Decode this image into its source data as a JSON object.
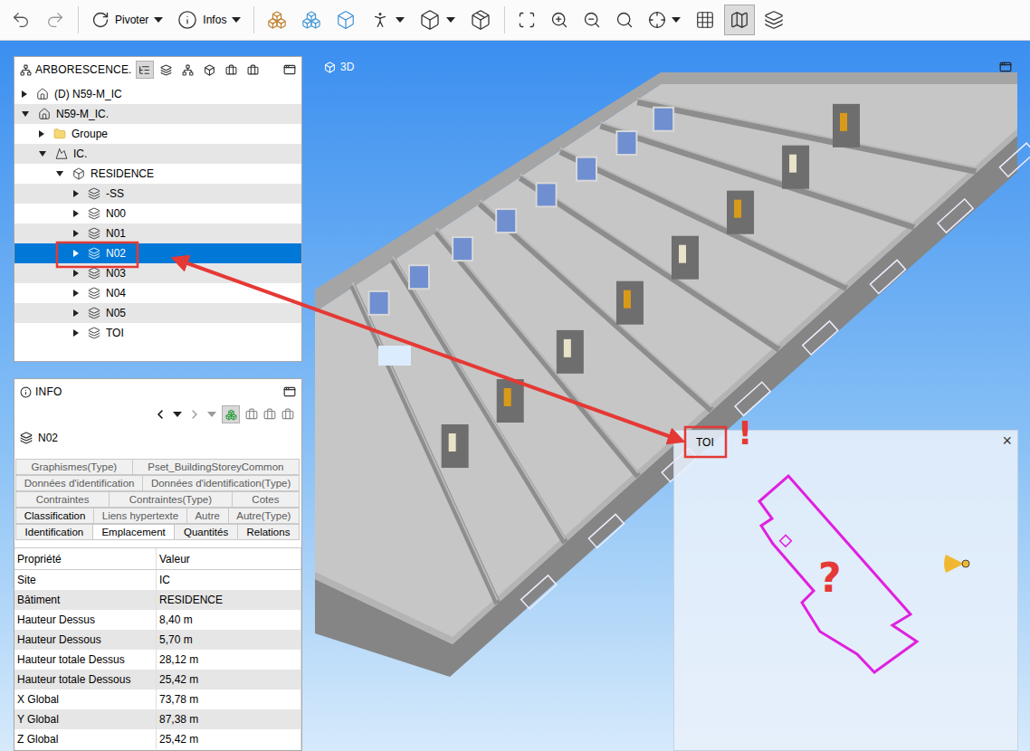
{
  "toolbar": {
    "rotate_label": "Pivoter",
    "info_label": "Infos",
    "map_view_pressed": true
  },
  "tree": {
    "title": "ARBORESCENCE.",
    "items": [
      {
        "label": "(D) N59-M_IC",
        "kind": "project",
        "depth": 0,
        "expanded": false,
        "selected": false
      },
      {
        "label": "N59-M_IC.",
        "kind": "project",
        "depth": 0,
        "expanded": true,
        "selected": false
      },
      {
        "label": "Groupe",
        "kind": "group",
        "depth": 1,
        "expanded": false,
        "selected": false
      },
      {
        "label": "IC.",
        "kind": "site",
        "depth": 1,
        "expanded": true,
        "selected": false
      },
      {
        "label": "RESIDENCE",
        "kind": "building",
        "depth": 2,
        "expanded": true,
        "selected": false
      },
      {
        "label": "-SS",
        "kind": "storey",
        "depth": 3,
        "expanded": false,
        "selected": false
      },
      {
        "label": "N00",
        "kind": "storey",
        "depth": 3,
        "expanded": false,
        "selected": false
      },
      {
        "label": "N01",
        "kind": "storey",
        "depth": 3,
        "expanded": false,
        "selected": false
      },
      {
        "label": "N02",
        "kind": "storey",
        "depth": 3,
        "expanded": false,
        "selected": true
      },
      {
        "label": "N03",
        "kind": "storey",
        "depth": 3,
        "expanded": false,
        "selected": false
      },
      {
        "label": "N04",
        "kind": "storey",
        "depth": 3,
        "expanded": false,
        "selected": false
      },
      {
        "label": "N05",
        "kind": "storey",
        "depth": 3,
        "expanded": false,
        "selected": false
      },
      {
        "label": "TOI",
        "kind": "storey",
        "depth": 3,
        "expanded": false,
        "selected": false
      }
    ]
  },
  "info": {
    "title": "INFO",
    "element": "N02",
    "tab_rows": [
      [
        {
          "label": "Graphismes(Type)",
          "selected": false,
          "dimmed": true
        },
        {
          "label": "Pset_BuildingStoreyCommon",
          "selected": false,
          "dimmed": true
        }
      ],
      [
        {
          "label": "Données d'identification",
          "selected": false,
          "dimmed": true
        },
        {
          "label": "Données d'identification(Type)",
          "selected": false,
          "dimmed": true
        }
      ],
      [
        {
          "label": "Contraintes",
          "selected": false,
          "dimmed": true
        },
        {
          "label": "Contraintes(Type)",
          "selected": false,
          "dimmed": true
        },
        {
          "label": "Cotes",
          "selected": false,
          "dimmed": true
        }
      ],
      [
        {
          "label": "Classification",
          "selected": false,
          "dimmed": false
        },
        {
          "label": "Liens hypertexte",
          "selected": false,
          "dimmed": true
        },
        {
          "label": "Autre",
          "selected": false,
          "dimmed": true
        },
        {
          "label": "Autre(Type)",
          "selected": false,
          "dimmed": true
        }
      ],
      [
        {
          "label": "Identification",
          "selected": false,
          "dimmed": false
        },
        {
          "label": "Emplacement",
          "selected": true,
          "dimmed": false
        },
        {
          "label": "Quantités",
          "selected": false,
          "dimmed": false
        },
        {
          "label": "Relations",
          "selected": false,
          "dimmed": false
        }
      ]
    ],
    "table": {
      "columns": [
        "Propriété",
        "Valeur"
      ],
      "rows": [
        [
          "Site",
          "IC"
        ],
        [
          "Bâtiment",
          "RESIDENCE"
        ],
        [
          "Hauteur Dessus",
          "8,40 m"
        ],
        [
          "Hauteur Dessous",
          "5,70 m"
        ],
        [
          "Hauteur totale Dessus",
          "28,12 m"
        ],
        [
          "Hauteur totale Dessous",
          "25,42 m"
        ],
        [
          "X Global",
          "73,78 m"
        ],
        [
          "Y Global",
          "87,38 m"
        ],
        [
          "Z Global",
          "25,42 m"
        ]
      ]
    }
  },
  "viewport": {
    "title": "3D"
  },
  "minimap": {
    "title": "TOI",
    "close": "×"
  },
  "annotations": {
    "exclamation": "!",
    "question": "?"
  }
}
